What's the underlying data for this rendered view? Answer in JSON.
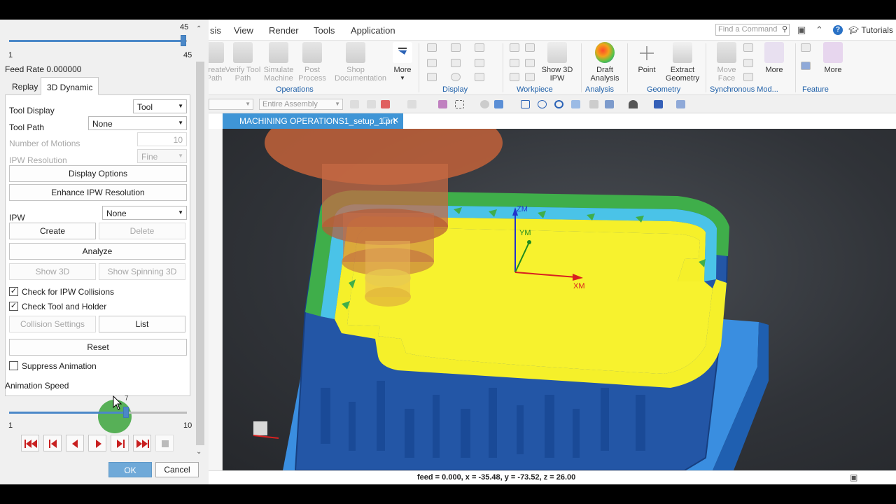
{
  "menu": {
    "items": [
      "sis",
      "View",
      "Render",
      "Tools",
      "Application"
    ]
  },
  "topbar": {
    "find_placeholder": "Find a Command",
    "tutorials": "Tutorials"
  },
  "ribbon": {
    "operations": [
      "Create Path",
      "Verify Tool Path",
      "Simulate Machine",
      "Post Process",
      "Shop Documentation"
    ],
    "operations_more": "More",
    "show_3d_ipw": "Show 3D IPW",
    "draft_analysis": "Draft Analysis",
    "point": "Point",
    "extract_geometry": "Extract Geometry",
    "move_face": "Move Face",
    "more2": "More",
    "more3": "More",
    "groups": [
      "Operations",
      "Display",
      "Workpiece",
      "Analysis",
      "Geometry",
      "Synchronous Mod...",
      "Feature"
    ]
  },
  "toolbar2": {
    "filter": "Entire Assembly"
  },
  "doc_tab": {
    "title": "MACHINING OPERATIONS1_setup_1.prt"
  },
  "viewport": {
    "axis_zm": "ZM",
    "axis_ym": "YM",
    "axis_xm": "XM"
  },
  "status": {
    "text": "feed = 0.000, x = -35.48, y = -73.52, z = 26.00"
  },
  "dialog": {
    "motion_slider": {
      "value": 45,
      "min": "1",
      "max": "45",
      "current_label": "45"
    },
    "feed_rate": "Feed Rate 0.000000",
    "tabs": [
      "Replay",
      "3D Dynamic"
    ],
    "active_tab": "3D Dynamic",
    "tool_display": {
      "label": "Tool Display",
      "value": "Tool"
    },
    "tool_path": {
      "label": "Tool Path",
      "value": "None"
    },
    "num_motions": {
      "label": "Number of Motions",
      "value": "10"
    },
    "ipw_resolution": {
      "label": "IPW Resolution",
      "value": "Fine"
    },
    "display_options": "Display Options",
    "enhance_ipw": "Enhance IPW Resolution",
    "ipw": {
      "label": "IPW",
      "value": "None"
    },
    "create": "Create",
    "delete": "Delete",
    "analyze": "Analyze",
    "show_3d": "Show 3D",
    "show_spinning_3d": "Show Spinning 3D",
    "check_ipw_collisions": {
      "label": "Check for IPW Collisions",
      "checked": true
    },
    "check_tool_holder": {
      "label": "Check Tool and Holder",
      "checked": true
    },
    "collision_settings": "Collision Settings",
    "list": "List",
    "reset": "Reset",
    "suppress_animation": {
      "label": "Suppress Animation",
      "checked": false
    },
    "animation_speed": {
      "label": "Animation Speed",
      "value": 7,
      "min": "1",
      "max": "10",
      "tooltip": "7"
    },
    "ok": "OK",
    "cancel": "Cancel"
  },
  "colors": {
    "accent": "#3f95d6",
    "part_yellow": "#f5f02a",
    "part_blue": "#2a62b6",
    "halo_green": "#3ca53c"
  }
}
